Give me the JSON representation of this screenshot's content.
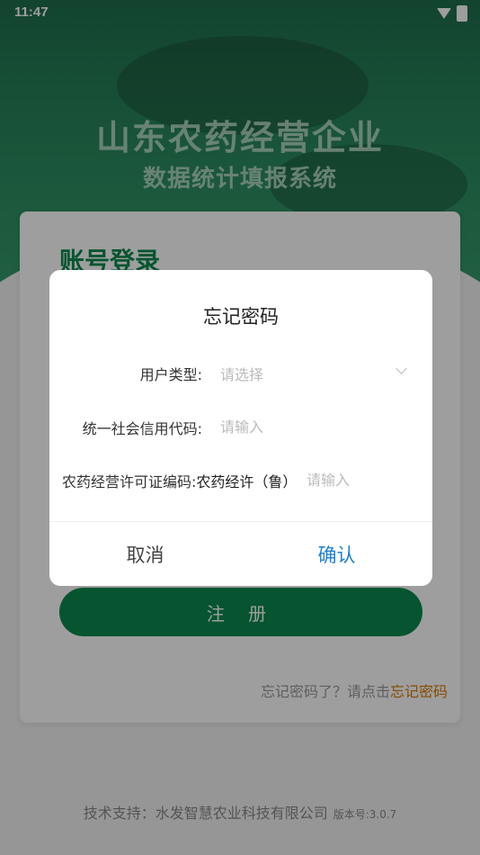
{
  "status_bar": {
    "time": "11:47"
  },
  "header": {
    "title": "山东农药经营企业",
    "subtitle": "数据统计填报系统"
  },
  "login_card": {
    "heading": "账号登录",
    "register_label": "注 册",
    "forgot_hint": "忘记密码了？请点击",
    "forgot_link": "忘记密码"
  },
  "footer": {
    "support": "技术支持：水发智慧农业科技有限公司",
    "version": "版本号:3.0.7"
  },
  "dialog": {
    "title": "忘记密码",
    "user_type_label": "用户类型:",
    "user_type_placeholder": "请选择",
    "credit_code_label": "统一社会信用代码:",
    "credit_code_placeholder": "请输入",
    "license_label": "农药经营许可证编码:",
    "license_prefix": "农药经许（鲁）",
    "license_placeholder": "请输入",
    "cancel_label": "取消",
    "confirm_label": "确认"
  },
  "colors": {
    "brand_green": "#0a8a4e",
    "link_orange": "#d97a00",
    "confirm_blue": "#1e7fd6"
  }
}
